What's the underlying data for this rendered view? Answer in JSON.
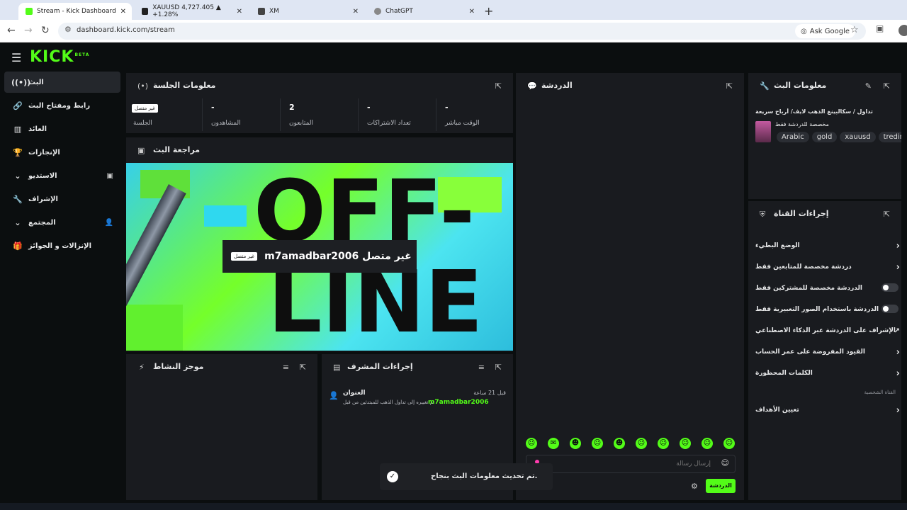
{
  "browser": {
    "tabs": [
      {
        "title": "Stream - Kick Dashboard",
        "active": true
      },
      {
        "title": "XAUUSD 4,727.405 ▲ +1.28%",
        "active": false
      },
      {
        "title": "XM",
        "active": false
      },
      {
        "title": "ChatGPT",
        "active": false
      }
    ],
    "url": "dashboard.kick.com/stream",
    "ask_google": "Ask Google"
  },
  "app": {
    "logo": "KICK",
    "logo_sup": "BETA"
  },
  "sidebar": {
    "items": [
      {
        "label": "البث",
        "icon": "broadcast-icon"
      },
      {
        "label": "رابط ومفتاح البث",
        "icon": "link-icon"
      },
      {
        "label": "العائد",
        "icon": "chart-icon"
      },
      {
        "label": "الإنجازات",
        "icon": "trophy-icon"
      },
      {
        "label": "الاستديو",
        "icon": "chevron-down-icon"
      },
      {
        "label": "الإشراف",
        "icon": "wrench-icon"
      },
      {
        "label": "المجتمع",
        "icon": "chevron-down-icon"
      },
      {
        "label": "الإنزالات و الجوائز",
        "icon": "gift-icon"
      }
    ]
  },
  "session": {
    "title": "معلومات الجلسة",
    "stats": [
      {
        "value": "غير متصل",
        "label": "الجلسة",
        "badge": true
      },
      {
        "value": "-",
        "label": "المشاهدون"
      },
      {
        "value": "2",
        "label": "المتابعون"
      },
      {
        "value": "-",
        "label": "تعداد الاشتراكات"
      },
      {
        "value": "-",
        "label": "الوقت مباشر"
      }
    ]
  },
  "preview": {
    "title": "مراجعة البث",
    "offline_text_1": "OFF-",
    "offline_text_2": "LINE",
    "tag": "غير متصل",
    "label": "m7amadbar2006 غير متصل"
  },
  "chat": {
    "title": "الدردشة",
    "placeholder": "إرسال رسالة",
    "send_label": "الدردشة",
    "emotes": [
      "☺",
      "✉",
      "☻",
      "☺",
      "☻",
      "☺",
      "☺",
      "☺",
      "☺",
      "☺"
    ]
  },
  "activity": {
    "title": "موجز النشاط"
  },
  "mod_actions": {
    "title": "إجراءات المشرف",
    "entry_title": "العنوان",
    "entry_time": "قبل 21 ساعة",
    "entry_text": "تم تغييره إلى تداول الذهب للمبتدئين من قبل",
    "entry_user": "m7amadbar2006"
  },
  "stream_info": {
    "title": "معلومات البث",
    "stream_title": "تداول / سكالبينغ الذهب لايف/ أرباح سريعة",
    "category": "مخصصة للدردشة فقط",
    "tags": [
      "Arabic",
      "gold",
      "xauusd",
      "treding"
    ]
  },
  "channel_actions": {
    "title": "إجراءات القناة",
    "items": [
      {
        "label": "الوضع البطيء",
        "type": "arrow"
      },
      {
        "label": "دردشة مخصصة للمتابعين فقط",
        "type": "arrow"
      },
      {
        "label": "الدردشة مخصصة للمشتركين فقط",
        "type": "toggle"
      },
      {
        "label": "الدردشة باستخدام الصور التعبيرية فقط",
        "type": "toggle"
      },
      {
        "label": "الإشراف على الدردشة عبر الذكاء الاصطناعي",
        "type": "link"
      },
      {
        "label": "القيود المفروضة على عمر الحساب",
        "type": "arrow"
      },
      {
        "label": "الكلمات المحظورة",
        "type": "arrow"
      }
    ],
    "section_label": "القناة الشخصية",
    "goals_label": "تعيين الأهداف"
  },
  "toast": {
    "message": "تم تحديث معلومات البث بنجاح."
  }
}
